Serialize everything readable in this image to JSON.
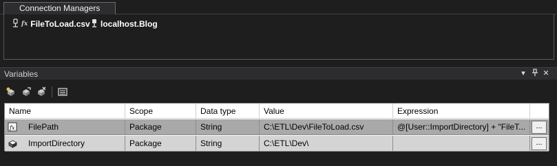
{
  "connection_managers": {
    "tab_label": "Connection Managers",
    "items": [
      {
        "name": "FileToLoad.csv",
        "icon": "flat-file-connection-icon",
        "expression_marker": "fx"
      },
      {
        "name": "localhost.Blog",
        "icon": "ole-db-connection-icon"
      }
    ]
  },
  "variables": {
    "title": "Variables",
    "title_buttons": [
      "window-position-dropdown",
      "pin",
      "close"
    ],
    "toolbar": [
      "add-variable",
      "move-variable",
      "delete-variable",
      "grid-options"
    ],
    "columns": [
      "Name",
      "Scope",
      "Data type",
      "Value",
      "Expression"
    ],
    "rows": [
      {
        "name": "FilePath",
        "scope": "Package",
        "data_type": "String",
        "value": "C:\\ETL\\Dev\\FileToLoad.csv",
        "expression": "@[User::ImportDirectory] + \"FileT...",
        "button": "...",
        "icon": "expression-variable-icon"
      },
      {
        "name": "ImportDirectory",
        "scope": "Package",
        "data_type": "String",
        "value": "C:\\ETL\\Dev\\",
        "expression": "",
        "button": "...",
        "icon": "variable-icon"
      }
    ]
  }
}
